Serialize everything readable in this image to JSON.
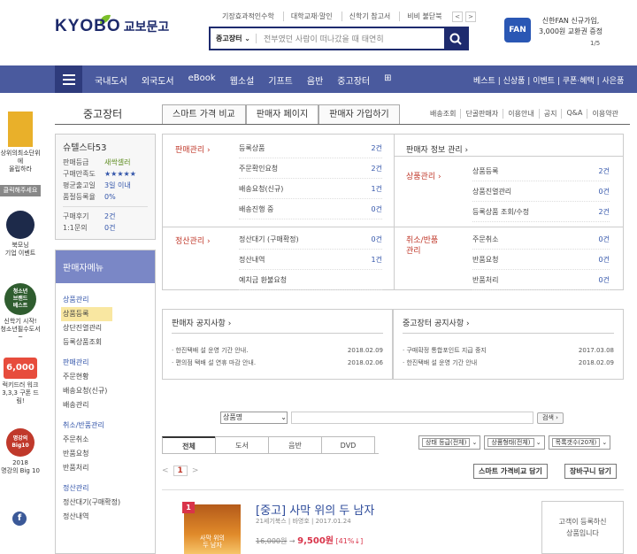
{
  "header": {
    "links": [
      "기장효과적인수학",
      "대학교재·말인",
      "신학기 참고서",
      "비비 불닫북"
    ],
    "arrows": [
      "<",
      ">"
    ],
    "logo_en": "KYOBO",
    "logo_kr": "교보문고",
    "search": {
      "category": "중고장터",
      "placeholder": "전부였던 사람이 떠나갔을 때 태연히"
    },
    "promo": {
      "badge": "FAN",
      "line1": "신한FAN 신규가입,",
      "line2": "3,000원 교환권 증정",
      "page": "1/5"
    }
  },
  "nav": {
    "items": [
      "국내도서",
      "외국도서",
      "eBook",
      "웹소설",
      "기프트",
      "음반",
      "중고장터"
    ],
    "right": "베스트 | 신상품 | 이벤트 | 쿠폰·혜택 | 사은품"
  },
  "left_promos": [
    {
      "label": "상위의최소단위에\n올립하라"
    },
    {
      "label": "클릭해주세요"
    },
    {
      "label": "북모닝\n기업 이벤트"
    },
    {
      "label": "청소년\n브랜드\n베스트"
    },
    {
      "label": "신학기 시작!\n청소년필수도서~"
    },
    {
      "label": "6,000"
    },
    {
      "label": "럭키드러 워크\n3,3,3 구폰 드림!"
    },
    {
      "label": "명강의 Big10"
    },
    {
      "label": "2018\n명강의 Big 10"
    },
    {
      "label": "f"
    }
  ],
  "page": {
    "title": "중고장터",
    "tabs": [
      "스마트 가격 비교",
      "판매자 페이지",
      "판매자 가입하기"
    ],
    "subtabs": [
      "배송조회",
      "단골판매자",
      "이용안내",
      "공지",
      "Q&A",
      "이용약관"
    ]
  },
  "profile": {
    "name": "슈텔스타53",
    "rows": [
      {
        "k": "판매등급",
        "v": "새싹셀러"
      },
      {
        "k": "구매만족도",
        "v": "★★★★★"
      },
      {
        "k": "평균출고일",
        "v": "3일 이내"
      },
      {
        "k": "품절등록율",
        "v": "0%"
      },
      {
        "k": "구매후기",
        "v": "2건"
      },
      {
        "k": "1:1문의",
        "v": "0건"
      }
    ]
  },
  "menu": {
    "head": "판매자메뉴",
    "groups": [
      {
        "title": "상품관리",
        "items": [
          "상품등록",
          "상단진열관리",
          "등록상품조회"
        ]
      },
      {
        "title": "판매관리",
        "items": [
          "주문현황",
          "배송요청(신규)",
          "배송관리"
        ]
      },
      {
        "title": "취소/반품관리",
        "items": [
          "주문취소",
          "반품요청",
          "반품처리"
        ]
      },
      {
        "title": "정산관리",
        "items": [
          "정산대기(구매확정)",
          "정산내역"
        ]
      }
    ]
  },
  "dashboard": {
    "sales_label": "판매관리",
    "sales": [
      [
        "등록상품",
        "2건"
      ],
      [
        "주문확인요청",
        "2건"
      ],
      [
        "배송요청(신규)",
        "1건"
      ],
      [
        "배송진행 중",
        "0건"
      ]
    ],
    "settle_label": "정산관리",
    "settle": [
      [
        "정산대기 (구매확정)",
        "0건"
      ],
      [
        "정산내역",
        "1건"
      ],
      [
        "예치금 환불요청",
        ""
      ]
    ],
    "info_label": "판매자 정보 관리",
    "goods_label": "상품관리",
    "goods": [
      [
        "상품등록",
        "2건"
      ],
      [
        "상품진열관리",
        "0건"
      ],
      [
        "등록상품 조회/수정",
        "2건"
      ]
    ],
    "cancel_label": "취소/반품\n관리",
    "cancel": [
      [
        "주문취소",
        "0건"
      ],
      [
        "반품요청",
        "0건"
      ],
      [
        "반품처리",
        "0건"
      ]
    ]
  },
  "notices": [
    {
      "title": "판매자 공지사항",
      "rows": [
        [
          "· 한진택배 설 운영 기간 안내.",
          "2018.02.09"
        ],
        [
          "· 편의점 택배 설 연휴 마감 안내.",
          "2018.02.06"
        ]
      ]
    },
    {
      "title": "중고장터 공지사항",
      "rows": [
        [
          "· 구매확정 통합포인트 지급 중지",
          "2017.03.08"
        ],
        [
          "· 한진택배 설 운영 기간 안내",
          "2018.02.09"
        ]
      ]
    }
  ],
  "search_bar": {
    "select": "상품명",
    "button": "검색"
  },
  "product_tabs": [
    "전체",
    "도서",
    "음반",
    "DVD"
  ],
  "filters": [
    "상태 등급(전체)",
    "상품형태(전체)",
    "목록갯수(20개)"
  ],
  "pager": {
    "prev": "<",
    "current": "1",
    "next": ">"
  },
  "buttons": {
    "compare": "스마트 가격비교 담기",
    "cart": "장바구니 담기"
  },
  "product": {
    "badge": "1",
    "cover_text": "사막 위의\n두 남자",
    "title": "[중고] 사막 위의 두 남자",
    "meta": "21세기북스 | 바영호 | 2017.01.24",
    "orig_price": "16,000원",
    "price": "9,500원",
    "discount": "[41%↓]",
    "side_note": "고객이 등록하신\n상품입니다"
  }
}
